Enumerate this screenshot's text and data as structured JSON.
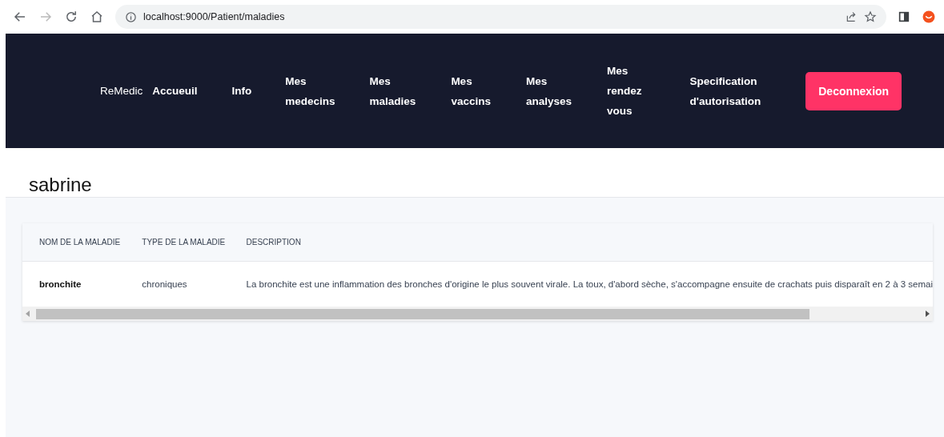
{
  "browser": {
    "url": "localhost:9000/Patient/maladies"
  },
  "navbar": {
    "brand": "ReMedic",
    "items": [
      "Accueuil",
      "Info",
      "Mes medecins",
      "Mes maladies",
      "Mes vaccins",
      "Mes analyses",
      "Mes rendez vous",
      "Specification d'autorisation"
    ],
    "logout_button": "Deconnexion"
  },
  "page": {
    "title": "sabrine"
  },
  "table": {
    "columns": [
      "NOM DE LA MALADIE",
      "TYPE DE LA MALADIE",
      "DESCRIPTION"
    ],
    "rows": [
      [
        "bronchite",
        "chroniques",
        "La bronchite est une inflammation des bronches d'origine le plus souvent virale. La toux, d'abord sèche, s'accompagne ensuite de crachats puis disparaît en 2 à 3 semai"
      ]
    ]
  }
}
